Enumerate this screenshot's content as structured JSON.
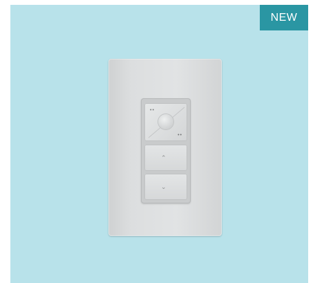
{
  "badge": {
    "label": "NEW"
  },
  "product": {
    "background_color": "#b8e2ea",
    "badge_color": "#2a96a3"
  },
  "icons": {
    "top_left": "indicator-dots-icon",
    "bottom_right": "indicator-dots-icon",
    "raise": "chevron-up-icon",
    "lower": "chevron-down-icon"
  }
}
